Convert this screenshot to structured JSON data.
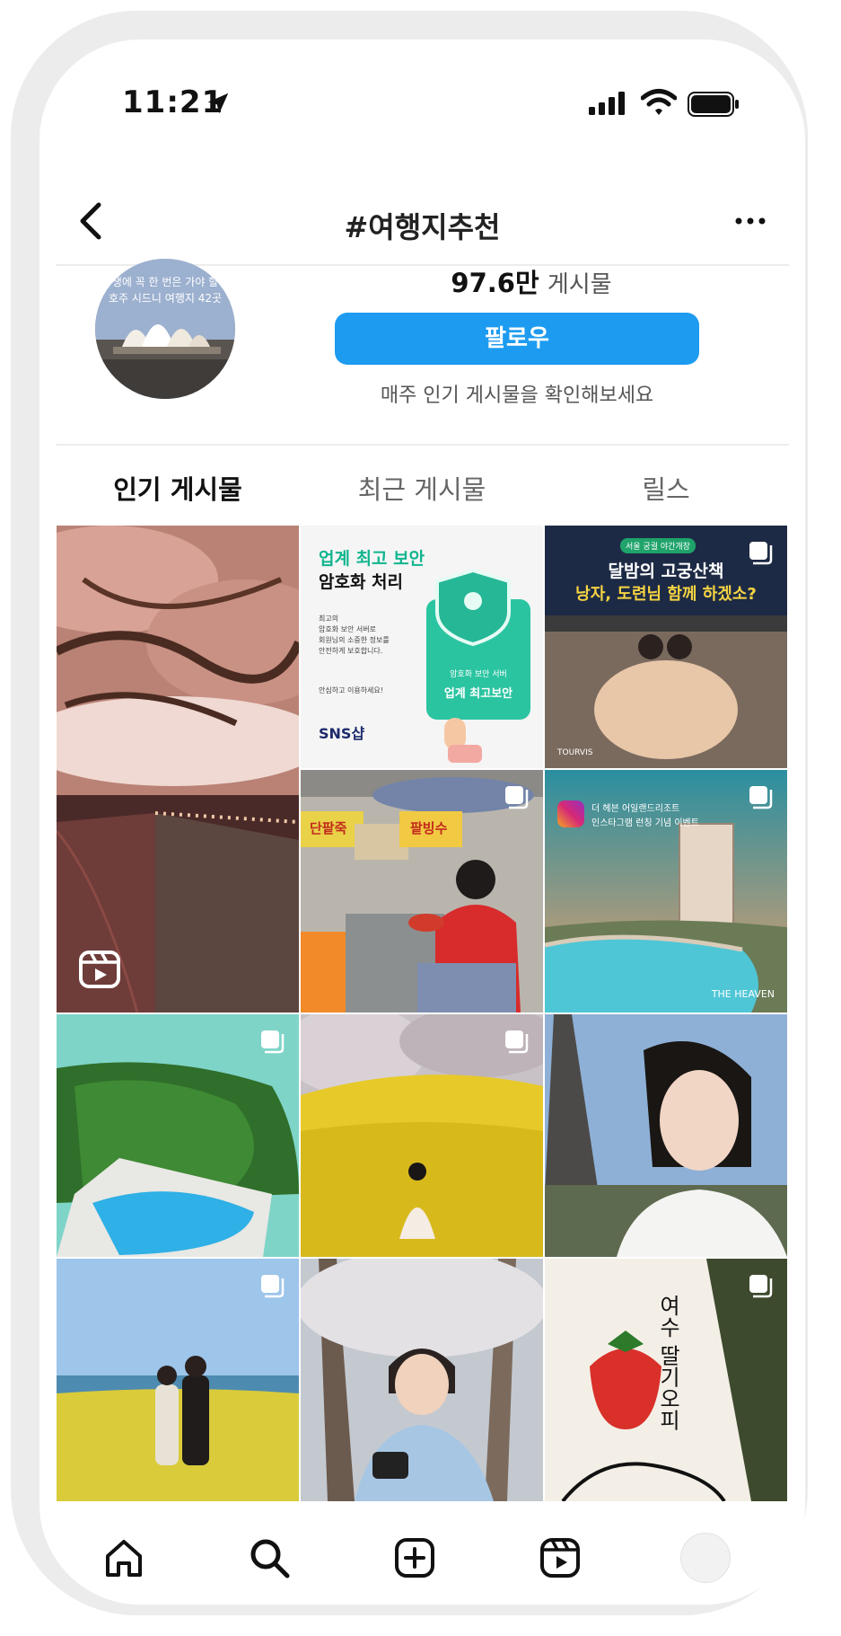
{
  "status_bar": {
    "time": "11:21"
  },
  "header": {
    "title": "#여행지추천",
    "back_icon": "chevron-left-icon",
    "more_icon": "more-horizontal-icon"
  },
  "hashtag": {
    "avatar_text_line1": "생에 꼭 한 번은 가야 할",
    "avatar_text_line2": "호주 시드니 여행지 42곳",
    "post_count_value": "97.6만",
    "post_count_label": "게시물",
    "follow_label": "팔로우",
    "follow_caption": "매주 인기 게시물을 확인해보세요"
  },
  "tabs": [
    {
      "label": "인기 게시물",
      "active": true
    },
    {
      "label": "최근 게시물",
      "active": false
    },
    {
      "label": "릴스",
      "active": false
    }
  ],
  "posts": [
    {
      "subject": "cherry blossom riverside night",
      "type": "reel"
    },
    {
      "subject": "encryption security ad",
      "type": "single",
      "title_green": "업계 최고 보안",
      "title_black": "암호화 처리",
      "body": [
        "최고의",
        "암호화 보안 서버로",
        "회원님의 소중한 정보를",
        "안전하게 보호합니다."
      ],
      "body2": "안심하고 이용하세요!",
      "card_line1": "암호화 보안 서버",
      "card_line2": "업계 최고보안",
      "brand": "SNS샵"
    },
    {
      "subject": "palace night walk hanbok",
      "type": "carousel",
      "tag": "서울 궁궐 야간개장",
      "headline1": "달밤의 고궁산책",
      "headline2": "낭자, 도련님 함께 하겠소?",
      "footer": "TOURVIS"
    },
    {
      "subject": "cherry blossom wide",
      "type": "reel-continued"
    },
    {
      "subject": "market food",
      "type": "carousel",
      "sign1": "단팥죽",
      "sign2": "팥빙수"
    },
    {
      "subject": "resort pool event",
      "type": "carousel",
      "line1": "더 헤븐 어일랜드리조트",
      "line2": "인스타그램 런칭 기념 이벤트",
      "footer": "THE HEAVEN"
    },
    {
      "subject": "island pool aerial",
      "type": "carousel"
    },
    {
      "subject": "forsythia flowers",
      "type": "carousel"
    },
    {
      "subject": "eiffel tower selfie",
      "type": "single"
    },
    {
      "subject": "canola flowers couple",
      "type": "carousel"
    },
    {
      "subject": "camera man blossoms",
      "type": "single"
    },
    {
      "subject": "strawberry tote bag",
      "type": "carousel",
      "handwriting": "여수 딸기오피"
    }
  ],
  "bottom_nav": [
    "home-icon",
    "search-icon",
    "create-icon",
    "reels-icon",
    "profile-avatar"
  ]
}
